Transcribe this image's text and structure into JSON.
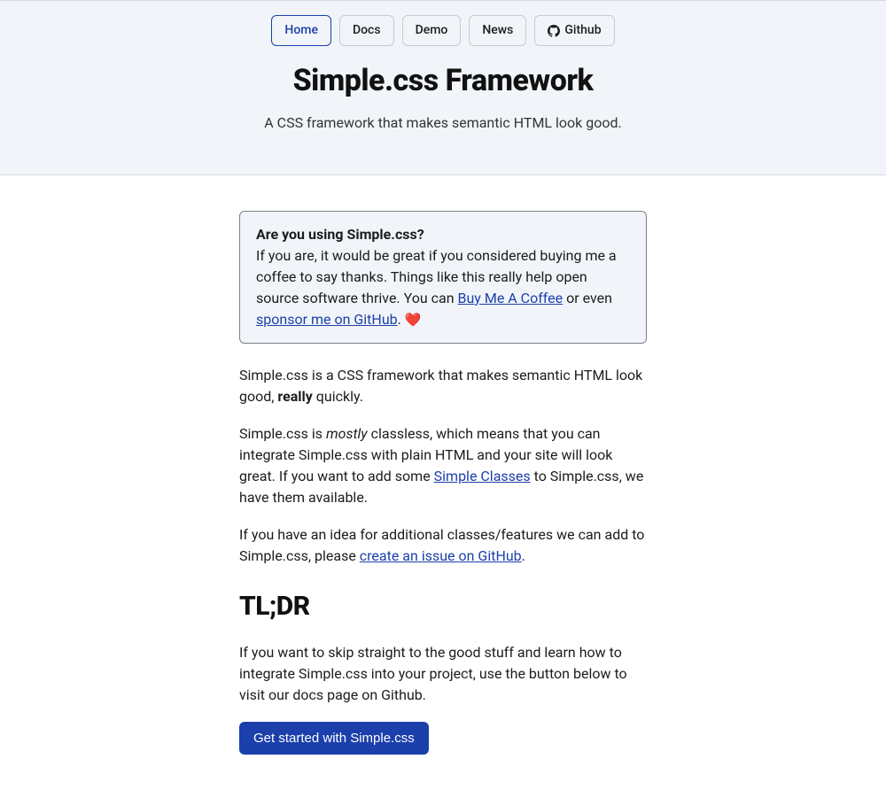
{
  "nav": {
    "items": [
      {
        "label": "Home",
        "active": true
      },
      {
        "label": "Docs",
        "active": false
      },
      {
        "label": "Demo",
        "active": false
      },
      {
        "label": "News",
        "active": false
      },
      {
        "label": "Github",
        "active": false,
        "icon": "github-icon"
      }
    ]
  },
  "header": {
    "title": "Simple.css Framework",
    "subtitle": "A CSS framework that makes semantic HTML look good."
  },
  "callout": {
    "heading": "Are you using Simple.css?",
    "text_before_link1": "If you are, it would be great if you considered buying me a coffee to say thanks. Things like this really help open source software thrive. You can ",
    "link1": "Buy Me A Coffee",
    "between_links": " or even ",
    "link2": "sponsor me on GitHub",
    "after_link2": ". ",
    "heart": "❤️"
  },
  "intro": {
    "p1_before_bold": "Simple.css is a CSS framework that makes semantic HTML look good, ",
    "p1_bold": "really",
    "p1_after_bold": " quickly.",
    "p2_before_italic": "Simple.css is ",
    "p2_italic": "mostly",
    "p2_after_italic": " classless, which means that you can integrate Simple.css with plain HTML and your site will look great. If you want to add some ",
    "p2_link": "Simple Classes",
    "p2_after_link": " to Simple.css, we have them available.",
    "p3_text": "If you have an idea for additional classes/features we can add to Simple.css, please ",
    "p3_link": "create an issue on GitHub",
    "p3_after": "."
  },
  "tldr": {
    "heading": "TL;DR",
    "text": "If you want to skip straight to the good stuff and learn how to integrate Simple.css into your project, use the button below to visit our docs page on Github.",
    "button": "Get started with Simple.css"
  }
}
